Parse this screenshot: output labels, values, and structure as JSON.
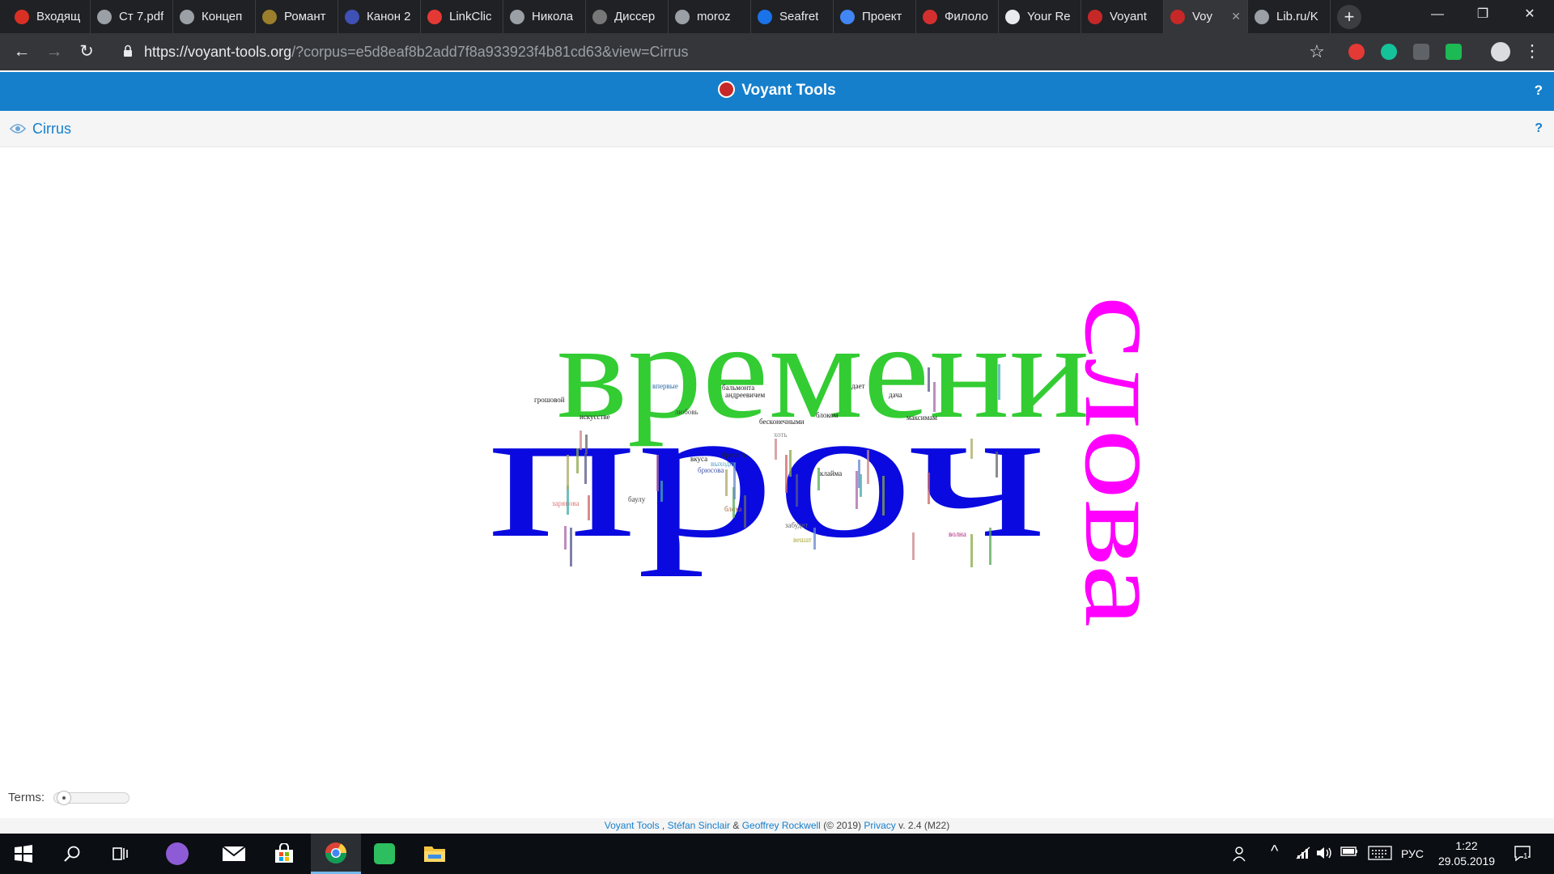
{
  "browser": {
    "tabs": [
      {
        "label": "Входящ",
        "icon": "gmail-icon",
        "color": "#d93025"
      },
      {
        "label": "Ст 7.pdf",
        "icon": "globe-icon",
        "color": "#9aa0a6"
      },
      {
        "label": "Концеп",
        "icon": "seal-icon",
        "color": "#9aa0a6"
      },
      {
        "label": "Романт",
        "icon": "book-icon",
        "color": "#9c7f2c"
      },
      {
        "label": "Канон 2",
        "icon": "r-icon",
        "color": "#3f51b5"
      },
      {
        "label": "LinkClic",
        "icon": "link-icon",
        "color": "#e53935"
      },
      {
        "label": "Никола",
        "icon": "book-open-icon",
        "color": "#9aa0a6"
      },
      {
        "label": "Диссер",
        "icon": "seal-icon",
        "color": "#777777"
      },
      {
        "label": "moroz",
        "icon": "globe-icon",
        "color": "#9aa0a6"
      },
      {
        "label": "Seafret",
        "icon": "chat-icon",
        "color": "#1a73e8"
      },
      {
        "label": "Проект",
        "icon": "docs-icon",
        "color": "#4285f4"
      },
      {
        "label": "Филоло",
        "icon": "pdf-icon",
        "color": "#d32f2f"
      },
      {
        "label": "Your Re",
        "icon": "github-icon",
        "color": "#e8eaed"
      },
      {
        "label": "Voyant",
        "icon": "voyant-icon",
        "color": "#c62828"
      },
      {
        "label": "Voy",
        "icon": "voyant-icon",
        "color": "#c62828",
        "active": true
      },
      {
        "label": "Lib.ru/K",
        "icon": "lib-icon",
        "color": "#9aa0a6"
      }
    ],
    "url_host": "https://voyant-tools.org",
    "url_path": "/?corpus=e5d8eaf8b2add7f8a933923f4b81cd63&view=Cirrus",
    "icons": {
      "back": "←",
      "forward": "→",
      "reload": "↻",
      "star": "☆",
      "menu": "⋮",
      "plus": "+",
      "minimize": "—",
      "restore": "❐",
      "close": "✕",
      "tab_close": "✕"
    }
  },
  "app": {
    "title": "Voyant Tools",
    "help": "?",
    "panel_title": "Cirrus",
    "panel_help": "?",
    "terms_label": "Terms:",
    "terms_slider_fraction": 0.05,
    "brand_color": "#157fcc"
  },
  "cloud": {
    "big_words": [
      {
        "text": "проч",
        "color": "#0a0ae0"
      },
      {
        "text": "времени",
        "color": "#33cc33"
      },
      {
        "text": "слова",
        "color": "#ff00ff"
      }
    ],
    "small_words": [
      {
        "text": "впервые",
        "color": "#2a6aa8"
      },
      {
        "text": "бальмонта",
        "color": "#222222"
      },
      {
        "text": "андреевичем",
        "color": "#222222"
      },
      {
        "text": "грошовой",
        "color": "#222222"
      },
      {
        "text": "искусстве",
        "color": "#222222"
      },
      {
        "text": "любовь",
        "color": "#444444"
      },
      {
        "text": "дает",
        "color": "#222222"
      },
      {
        "text": "дача",
        "color": "#222222"
      },
      {
        "text": "блоком",
        "color": "#222222"
      },
      {
        "text": "максимам",
        "color": "#222222"
      },
      {
        "text": "бесконечными",
        "color": "#222222"
      },
      {
        "text": "хоть",
        "color": "#888888"
      },
      {
        "text": "бросить",
        "color": "#222222"
      },
      {
        "text": "брюсова",
        "color": "#4455aa"
      },
      {
        "text": "вкуса",
        "color": "#222222"
      },
      {
        "text": "выходят",
        "color": "#5aa0c8"
      },
      {
        "text": "блоха",
        "color": "#aa6633"
      },
      {
        "text": "клайма",
        "color": "#222222"
      },
      {
        "text": "баулу",
        "color": "#444444"
      },
      {
        "text": "забудет",
        "color": "#666666"
      },
      {
        "text": "вешат",
        "color": "#aaaa33"
      },
      {
        "text": "волна",
        "color": "#aa2277"
      },
      {
        "text": "зарянова",
        "color": "#dd7777"
      }
    ]
  },
  "footer": {
    "link1": "Voyant Tools",
    "sep1": ",",
    "author1": "Stéfan Sinclair",
    "amp": "&",
    "author2": "Geoffrey Rockwell",
    "year": "(© 2019)",
    "privacy": "Privacy",
    "version": "v. 2.4 (M22)"
  },
  "taskbar": {
    "language": "РУС",
    "time": "1:22",
    "date": "29.05.2019",
    "notifications": "1"
  }
}
